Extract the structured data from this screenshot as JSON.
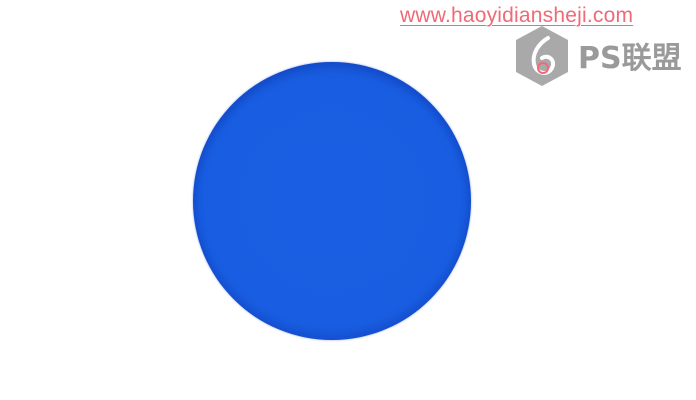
{
  "watermark": {
    "url_text": "www.haoyidiansheji.com",
    "logo_text": "PS联盟",
    "url_color": "#f06a76",
    "logo_color": "#9a9a9a"
  },
  "shape": {
    "kind": "circle",
    "fill_color": "#1a5fe3",
    "edge_color": "#2750d6"
  },
  "background_color": "#ffffff"
}
